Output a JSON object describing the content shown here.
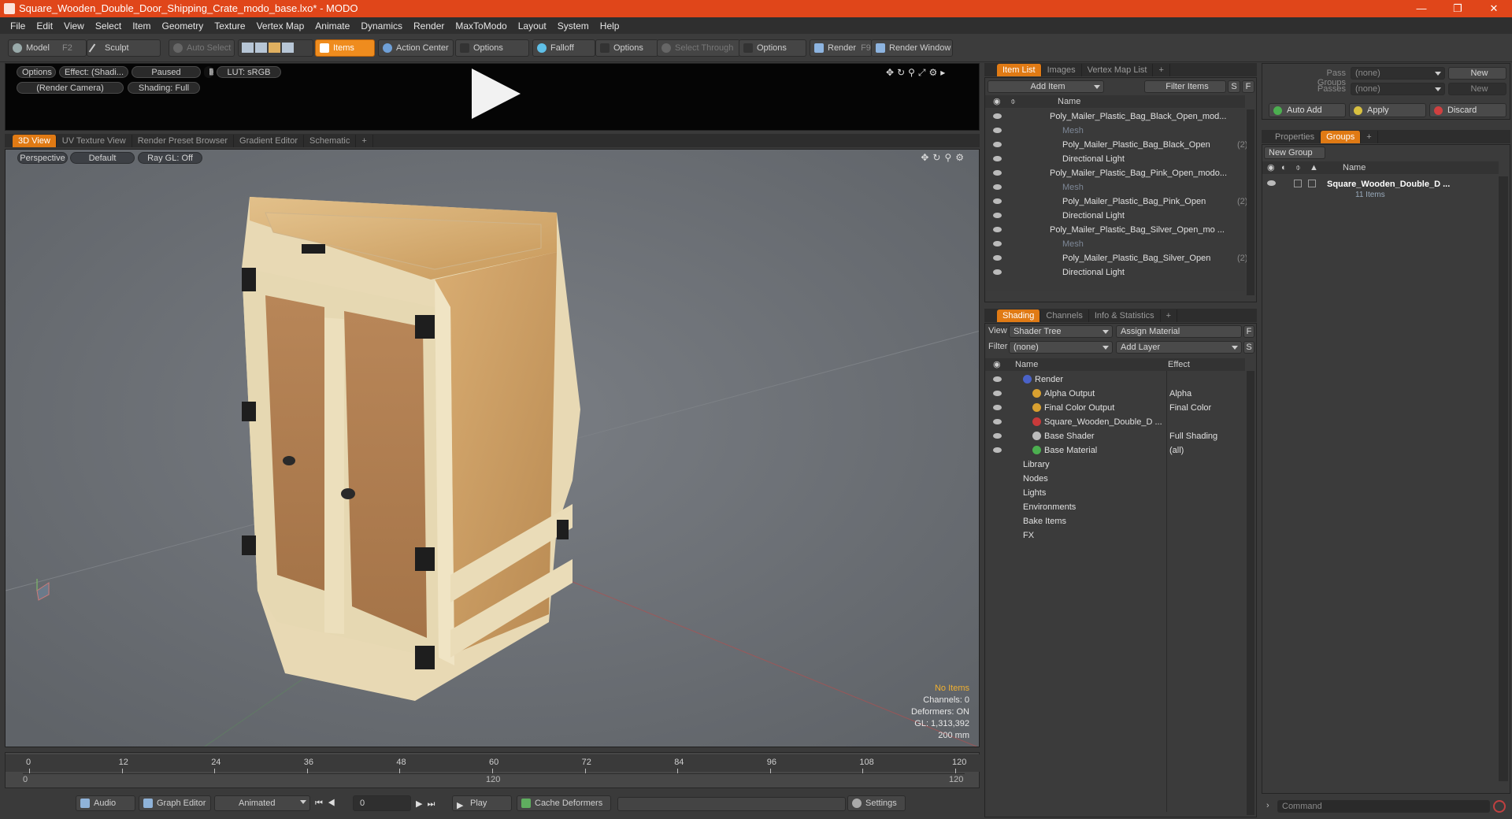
{
  "window": {
    "title": "Square_Wooden_Double_Door_Shipping_Crate_modo_base.lxo* - MODO"
  },
  "menu": [
    "File",
    "Edit",
    "View",
    "Select",
    "Item",
    "Geometry",
    "Texture",
    "Vertex Map",
    "Animate",
    "Dynamics",
    "Render",
    "MaxToModo",
    "Layout",
    "System",
    "Help"
  ],
  "toolbar": {
    "model": "Model",
    "model_key": "F2",
    "sculpt": "Sculpt",
    "auto_select": "Auto Select",
    "items": "Items",
    "action_center": "Action Center",
    "options1": "Options",
    "falloff": "Falloff",
    "options2": "Options",
    "select_through": "Select Through",
    "options3": "Options",
    "render": "Render",
    "render_key": "F9",
    "render_window": "Render Window"
  },
  "preview": {
    "options": "Options",
    "effect": "Effect: (Shadi...",
    "paused": "Paused",
    "lut": "LUT: sRGB",
    "camera": "(Render Camera)",
    "shading": "Shading: Full"
  },
  "viewport_tabs": [
    "3D View",
    "UV Texture View",
    "Render Preset Browser",
    "Gradient Editor",
    "Schematic",
    "+"
  ],
  "viewport": {
    "projection": "Perspective",
    "style": "Default",
    "raygl": "Ray GL: Off"
  },
  "stats": {
    "items": "No Items",
    "channels": "Channels: 0",
    "deformers": "Deformers: ON",
    "gl": "GL: 1,313,392",
    "scale": "200 mm"
  },
  "timeline": {
    "ticks": [
      "0",
      "12",
      "24",
      "36",
      "48",
      "60",
      "72",
      "84",
      "96",
      "108",
      "120"
    ],
    "start": "0",
    "mid": "120",
    "end": "120"
  },
  "bottom": {
    "audio": "Audio",
    "graph_editor": "Graph Editor",
    "animated": "Animated",
    "frame": "0",
    "play": "Play",
    "cache": "Cache Deformers",
    "settings": "Settings"
  },
  "itemlist": {
    "tabs": [
      "Item List",
      "Images",
      "Vertex Map List",
      "+"
    ],
    "add_item": "Add Item",
    "filter": "Filter Items",
    "s": "S",
    "f": "F",
    "col_name": "Name",
    "rows": [
      {
        "label": "Poly_Mailer_Plastic_Bag_Black_Open_mod...",
        "indent": 0,
        "dim": false,
        "count": ""
      },
      {
        "label": "Mesh",
        "indent": 1,
        "dim": true,
        "count": ""
      },
      {
        "label": "Poly_Mailer_Plastic_Bag_Black_Open",
        "indent": 1,
        "dim": false,
        "count": "(2)"
      },
      {
        "label": "Directional Light",
        "indent": 1,
        "dim": false,
        "count": ""
      },
      {
        "label": "Poly_Mailer_Plastic_Bag_Pink_Open_modo...",
        "indent": 0,
        "dim": false,
        "count": ""
      },
      {
        "label": "Mesh",
        "indent": 1,
        "dim": true,
        "count": ""
      },
      {
        "label": "Poly_Mailer_Plastic_Bag_Pink_Open",
        "indent": 1,
        "dim": false,
        "count": "(2)"
      },
      {
        "label": "Directional Light",
        "indent": 1,
        "dim": false,
        "count": ""
      },
      {
        "label": "Poly_Mailer_Plastic_Bag_Silver_Open_mo ...",
        "indent": 0,
        "dim": false,
        "count": ""
      },
      {
        "label": "Mesh",
        "indent": 1,
        "dim": true,
        "count": ""
      },
      {
        "label": "Poly_Mailer_Plastic_Bag_Silver_Open",
        "indent": 1,
        "dim": false,
        "count": "(2)"
      },
      {
        "label": "Directional Light",
        "indent": 1,
        "dim": false,
        "count": ""
      }
    ]
  },
  "shading": {
    "tabs": [
      "Shading",
      "Channels",
      "Info & Statistics",
      "+"
    ],
    "view_label": "View",
    "view_value": "Shader Tree",
    "assign": "Assign Material",
    "f": "F",
    "filter_label": "Filter",
    "filter_value": "(none)",
    "add_layer": "Add Layer",
    "s": "S",
    "col_name": "Name",
    "col_effect": "Effect",
    "rows": [
      {
        "label": "Render",
        "effect": "",
        "indent": 0,
        "color": "#4a62c8"
      },
      {
        "label": "Alpha Output",
        "effect": "Alpha",
        "indent": 1,
        "color": "#d8a030"
      },
      {
        "label": "Final Color Output",
        "effect": "Final Color",
        "indent": 1,
        "color": "#d8a030"
      },
      {
        "label": "Square_Wooden_Double_D ...",
        "effect": "",
        "indent": 1,
        "color": "#c83a3a"
      },
      {
        "label": "Base Shader",
        "effect": "Full Shading",
        "indent": 1,
        "color": "#bbbbbb"
      },
      {
        "label": "Base Material",
        "effect": "(all)",
        "indent": 1,
        "color": "#4caf50"
      },
      {
        "label": "Library",
        "effect": "",
        "indent": 0,
        "color": ""
      },
      {
        "label": "Nodes",
        "effect": "",
        "indent": 0,
        "color": ""
      },
      {
        "label": "Lights",
        "effect": "",
        "indent": 0,
        "color": ""
      },
      {
        "label": "Environments",
        "effect": "",
        "indent": 0,
        "color": ""
      },
      {
        "label": "Bake Items",
        "effect": "",
        "indent": 0,
        "color": ""
      },
      {
        "label": "FX",
        "effect": "",
        "indent": 0,
        "color": ""
      }
    ]
  },
  "passes": {
    "pass_groups": "Pass Groups",
    "passes": "Passes",
    "none1": "(none)",
    "none2": "(none)",
    "new1": "New",
    "new2": "New"
  },
  "actions": {
    "auto_add": "Auto Add",
    "apply": "Apply",
    "discard": "Discard"
  },
  "groups": {
    "tabs": [
      "Properties",
      "Groups",
      "+"
    ],
    "new_group": "New Group",
    "col_name": "Name",
    "item": "Square_Wooden_Double_D ...",
    "count": "11 Items"
  },
  "command": {
    "placeholder": "Command"
  }
}
